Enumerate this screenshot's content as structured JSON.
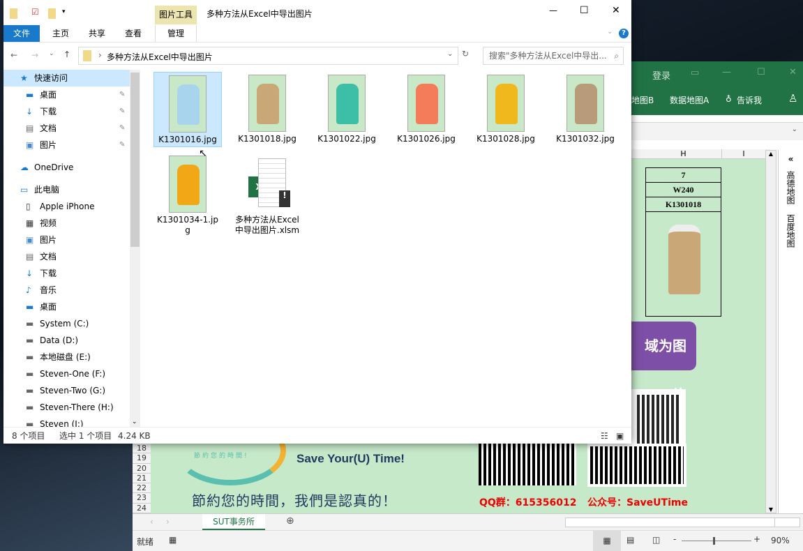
{
  "explorer": {
    "quick_access_toolbar": [
      "folder-icon",
      "properties-icon",
      "new-folder-icon",
      "dropdown-icon"
    ],
    "context_tab": "图片工具",
    "title": "多种方法从Excel中导出图片",
    "tabs": [
      "文件",
      "主页",
      "共享",
      "查看",
      "管理"
    ],
    "path": "多种方法从Excel中导出图片",
    "search_placeholder": "搜索\"多种方法从Excel中导出...",
    "nav": [
      {
        "label": "快速访问",
        "icon": "star-icon"
      },
      {
        "label": "桌面",
        "icon": "desktop-icon",
        "pinned": true
      },
      {
        "label": "下载",
        "icon": "download-icon",
        "pinned": true
      },
      {
        "label": "文档",
        "icon": "document-icon",
        "pinned": true
      },
      {
        "label": "图片",
        "icon": "picture-icon",
        "pinned": true
      },
      {
        "label": "OneDrive",
        "icon": "cloud-icon"
      },
      {
        "label": "此电脑",
        "icon": "computer-icon"
      },
      {
        "label": "Apple iPhone",
        "icon": "phone-icon"
      },
      {
        "label": "视频",
        "icon": "video-icon"
      },
      {
        "label": "图片",
        "icon": "picture-icon"
      },
      {
        "label": "文档",
        "icon": "document-icon"
      },
      {
        "label": "下载",
        "icon": "download-icon"
      },
      {
        "label": "音乐",
        "icon": "music-icon"
      },
      {
        "label": "桌面",
        "icon": "desktop-icon"
      },
      {
        "label": "System (C:)",
        "icon": "drive-icon"
      },
      {
        "label": "Data (D:)",
        "icon": "drive-icon"
      },
      {
        "label": "本地磁盘 (E:)",
        "icon": "drive-icon"
      },
      {
        "label": "Steven-One (F:)",
        "icon": "drive-icon"
      },
      {
        "label": "Steven-Two (G:)",
        "icon": "drive-icon"
      },
      {
        "label": "Steven-There (H:)",
        "icon": "drive-icon"
      },
      {
        "label": "Steven (I:)",
        "icon": "drive-icon"
      }
    ],
    "files": [
      {
        "name": "K1301016.jpg",
        "color": "#a9d4ee"
      },
      {
        "name": "K1301018.jpg",
        "color": "#c9a777"
      },
      {
        "name": "K1301022.jpg",
        "color": "#3cbfa6"
      },
      {
        "name": "K1301026.jpg",
        "color": "#f47c5a"
      },
      {
        "name": "K1301028.jpg",
        "color": "#f0b81c"
      },
      {
        "name": "K1301032.jpg",
        "color": "#b89b7a"
      },
      {
        "name": "K1301034-1.jpg",
        "color": "#f2a816"
      },
      {
        "name": "多种方法从Excel中导出图片.xlsm",
        "color": "#217346"
      }
    ],
    "status": {
      "count": "8 个项目",
      "selected": "选中 1 个项目",
      "size": "4.24 KB"
    }
  },
  "excel": {
    "login": "登录",
    "ribbon": [
      "地图B",
      "数据地图A",
      "告诉我"
    ],
    "columns": [
      "H",
      "I"
    ],
    "card": [
      "7",
      "W240",
      "K1301018"
    ],
    "button_text": "域为图片",
    "side_panel": [
      "高德地图",
      "百度地图"
    ],
    "rows": [
      "18",
      "19",
      "20",
      "21",
      "22",
      "23",
      "24"
    ],
    "slogan_en": "Save Your(U) Time!",
    "slogan_logo": "節約您的時間!",
    "slogan_cn": "節約您的時間，我們是認真的！",
    "qq": "QQ群：615356012",
    "wechat": "公众号：SaveUTime",
    "sheet_tab": "SUT事务所",
    "status": "就绪",
    "zoom": "90%",
    "zoom_percent": 90
  }
}
